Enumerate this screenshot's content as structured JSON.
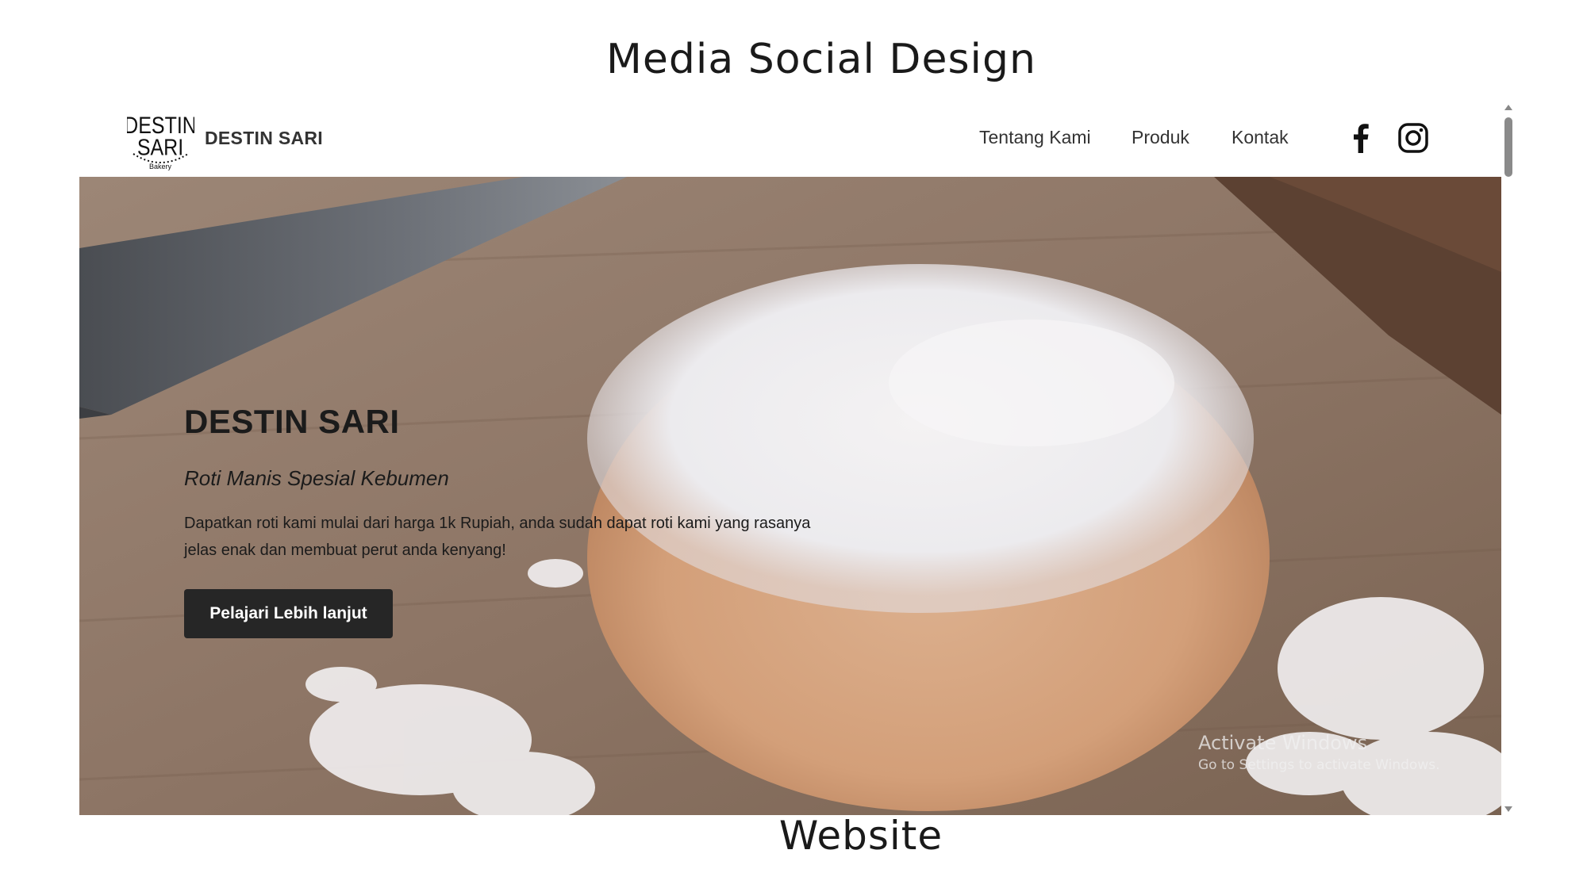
{
  "slide": {
    "title": "Media Social Design",
    "caption": "Website"
  },
  "navbar": {
    "brand_name": "DESTIN SARI",
    "logo_text_top": "DESTIN",
    "logo_text_bottom": "SARI",
    "logo_text_small": "Bakery",
    "links": [
      {
        "label": "Tentang Kami"
      },
      {
        "label": "Produk"
      },
      {
        "label": "Kontak"
      }
    ],
    "social_icons": [
      "facebook-icon",
      "instagram-icon"
    ]
  },
  "hero": {
    "title": "DESTIN SARI",
    "subtitle": "Roti Manis Spesial Kebumen",
    "description": "Dapatkan roti kami mulai dari harga 1k Rupiah, anda sudah dapat roti kami yang rasanya jelas enak dan membuat perut anda kenyang!",
    "button_label": "Pelajari Lebih lanjut",
    "background_image": "bread-dough-with-flour-on-wooden-board"
  },
  "watermark": {
    "title": "Activate Windows",
    "subtitle": "Go to Settings to activate Windows."
  },
  "colors": {
    "button_bg": "#262626",
    "text_dark": "#1b1b1b",
    "nav_text": "#333333"
  }
}
